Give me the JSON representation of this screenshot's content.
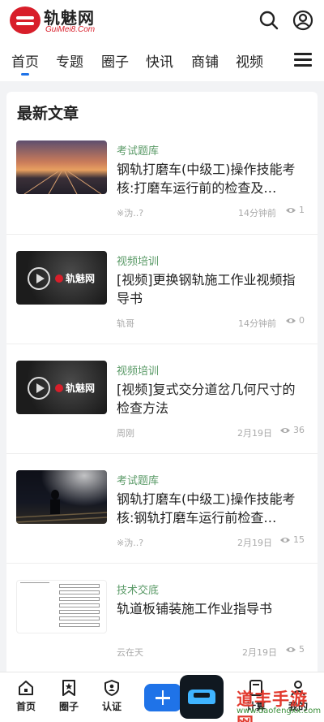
{
  "header": {
    "logo_name": "轨魅网",
    "logo_sub": "GuiMei8.Com"
  },
  "nav": {
    "tabs": [
      "首页",
      "专题",
      "圈子",
      "快讯",
      "商铺",
      "视频"
    ],
    "active": "首页"
  },
  "section": {
    "title": "最新文章"
  },
  "articles": [
    {
      "category": "考试题库",
      "title": "钢轨打磨车(中级工)操作技能考核:打磨车运行前的检查及…",
      "author": "※沩..?",
      "time": "14分钟前",
      "views": "1"
    },
    {
      "category": "视频培训",
      "title": "[视频]更换钢轨施工作业视频指导书",
      "author": "轨哥",
      "time": "14分钟前",
      "views": "0",
      "thumb_text": "轨魅网"
    },
    {
      "category": "视频培训",
      "title": "[视频]复式交分道岔几何尺寸的检查方法",
      "author": "周刚",
      "time": "2月19日",
      "views": "36",
      "thumb_text": "轨魅网"
    },
    {
      "category": "考试题库",
      "title": "钢轨打磨车(中级工)操作技能考核:钢轨打磨车运行前检查…",
      "author": "※沩..?",
      "time": "2月19日",
      "views": "15"
    },
    {
      "category": "技术交底",
      "title": "轨道板铺装施工作业指导书",
      "author": "云在天",
      "time": "2月19日",
      "views": "5"
    }
  ],
  "bottom_nav": {
    "items": [
      "首页",
      "圈子",
      "认证",
      "计算",
      "我的"
    ]
  },
  "watermark": {
    "text": "道丰手游网",
    "url": "www.daofengxx.com"
  },
  "colors": {
    "accent": "#1f73e8",
    "brand_red": "#d81e2a",
    "category_green": "#5a9a67"
  }
}
